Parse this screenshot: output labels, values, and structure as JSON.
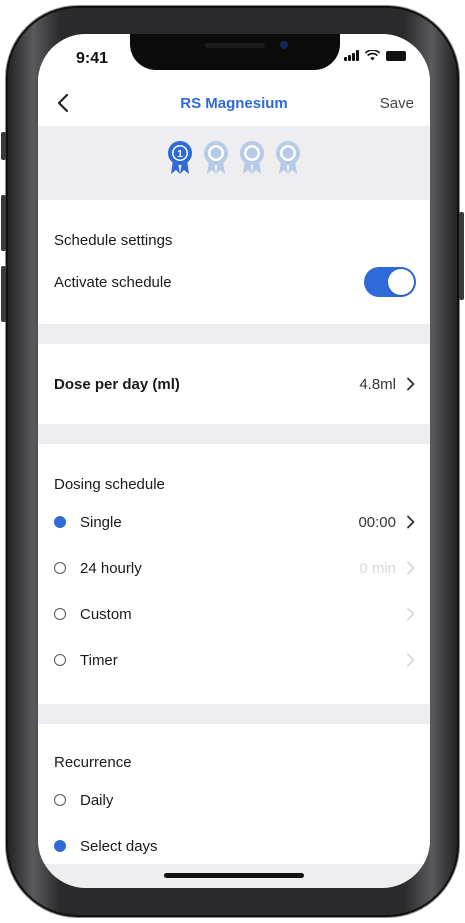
{
  "status_bar": {
    "time": "9:41"
  },
  "nav": {
    "title": "RS Magnesium",
    "save_label": "Save"
  },
  "steps": {
    "total": 4,
    "active_index": 0,
    "active_number": "1"
  },
  "schedule_settings": {
    "header": "Schedule settings",
    "activate_label": "Activate schedule",
    "activate_on": true
  },
  "dose": {
    "label": "Dose per day (ml)",
    "value": "4.8ml"
  },
  "dosing_schedule": {
    "header": "Dosing schedule",
    "options": [
      {
        "label": "Single",
        "value": "00:00",
        "selected": true
      },
      {
        "label": "24 hourly",
        "value": "0 min",
        "selected": false
      },
      {
        "label": "Custom",
        "value": "",
        "selected": false
      },
      {
        "label": "Timer",
        "value": "",
        "selected": false
      }
    ]
  },
  "recurrence": {
    "header": "Recurrence",
    "options": [
      {
        "label": "Daily",
        "selected": false
      },
      {
        "label": "Select days",
        "selected": true
      }
    ]
  },
  "colors": {
    "accent": "#2f6bd8",
    "step_inactive": "#b7cbe8",
    "background": "#eeeef0"
  },
  "icons": {
    "back": "chevron-left-icon",
    "step": "award-ribbon-icon",
    "row": "chevron-right-icon"
  }
}
